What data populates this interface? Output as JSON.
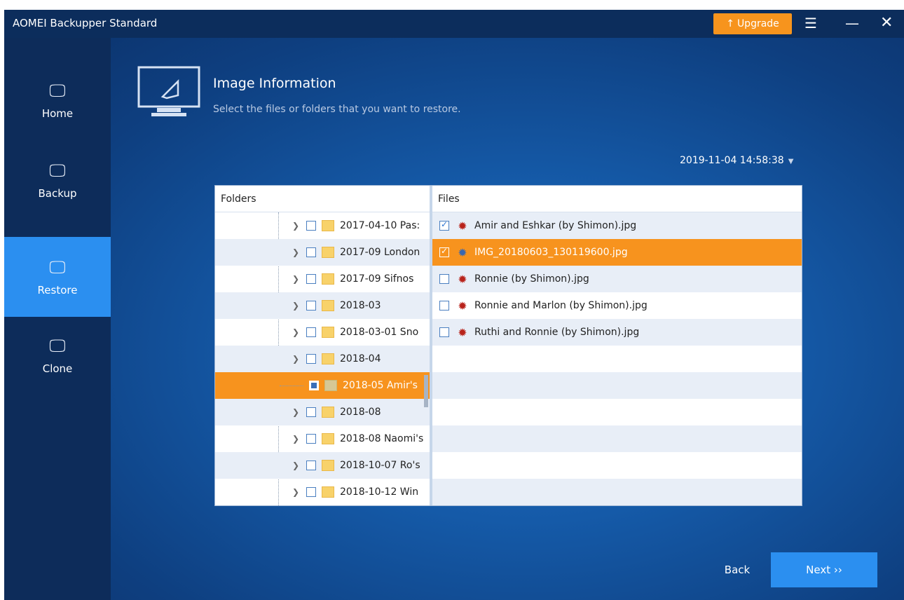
{
  "window": {
    "title": "AOMEI Backupper Standard",
    "upgrade_label": "Upgrade",
    "upgrade_icon": "upload-arrow-icon",
    "menu_icon": "menu-icon",
    "minimize_icon": "minimize-icon",
    "close_icon": "close-icon"
  },
  "sidebar": {
    "items": [
      {
        "label": "Home",
        "icon": "home-monitor-icon",
        "active": false
      },
      {
        "label": "Backup",
        "icon": "backup-monitor-icon",
        "active": false
      },
      {
        "label": "Restore",
        "icon": "restore-monitor-icon",
        "active": true
      },
      {
        "label": "Clone",
        "icon": "clone-monitor-icon",
        "active": false
      }
    ]
  },
  "header": {
    "title": "Image Information",
    "subtitle": "Select the files or folders that you want to restore.",
    "icon": "restore-monitor-icon"
  },
  "backup_point": {
    "datetime": "2019-11-04 14:58:38",
    "arrow_icon": "caret-down-icon"
  },
  "folders": {
    "header": "Folders",
    "items": [
      {
        "name": "2017-04-10 Pas:",
        "checked": "none",
        "selected": false
      },
      {
        "name": "2017-09 London",
        "checked": "none",
        "selected": false
      },
      {
        "name": "2017-09 Sifnos",
        "checked": "none",
        "selected": false
      },
      {
        "name": "2018-03",
        "checked": "none",
        "selected": false
      },
      {
        "name": "2018-03-01 Sno",
        "checked": "none",
        "selected": false
      },
      {
        "name": "2018-04",
        "checked": "none",
        "selected": false
      },
      {
        "name": "2018-05 Amir's",
        "checked": "mixed",
        "selected": true
      },
      {
        "name": "2018-08",
        "checked": "none",
        "selected": false
      },
      {
        "name": "2018-08 Naomi's",
        "checked": "none",
        "selected": false
      },
      {
        "name": "2018-10-07 Ro's",
        "checked": "none",
        "selected": false
      },
      {
        "name": "2018-10-12 Win",
        "checked": "none",
        "selected": false
      }
    ]
  },
  "files": {
    "header": "Files",
    "items": [
      {
        "name": "Amir and Eshkar (by Shimon).jpg",
        "checked": true,
        "selected": false
      },
      {
        "name": "IMG_20180603_130119600.jpg",
        "checked": true,
        "selected": true
      },
      {
        "name": "Ronnie  (by Shimon).jpg",
        "checked": false,
        "selected": false
      },
      {
        "name": "Ronnie and Marlon  (by Shimon).jpg",
        "checked": false,
        "selected": false
      },
      {
        "name": "Ruthi and Ronnie  (by Shimon).jpg",
        "checked": false,
        "selected": false
      }
    ]
  },
  "footer": {
    "back_label": "Back",
    "next_label": "Next ››"
  },
  "colors": {
    "accent": "#2b8ff0",
    "highlight": "#f7931e",
    "titlebar": "#0c2d5c"
  }
}
